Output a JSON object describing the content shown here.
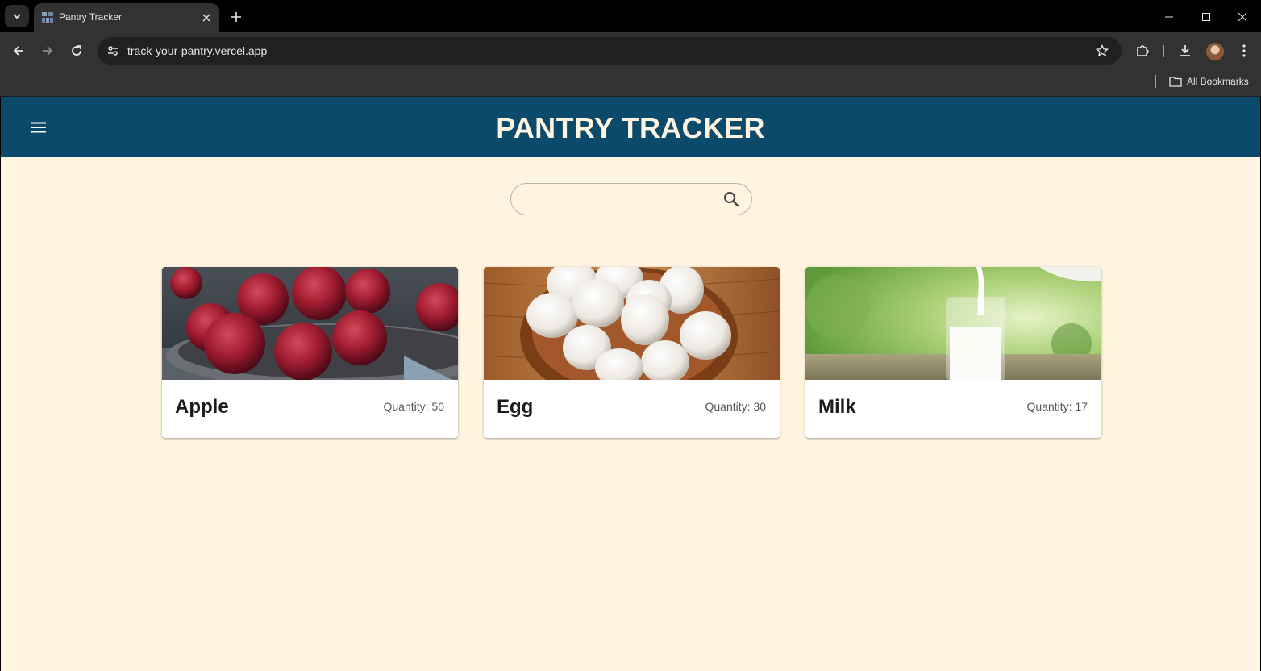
{
  "browser": {
    "tab_title": "Pantry Tracker",
    "url": "track-your-pantry.vercel.app",
    "bookmarks_label": "All Bookmarks"
  },
  "app": {
    "title": "PANTRY TRACKER",
    "search": {
      "value": "",
      "placeholder": ""
    }
  },
  "items": [
    {
      "name": "Apple",
      "quantity_label": "Quantity: 50",
      "quantity": 50,
      "image": "bowl of red apples"
    },
    {
      "name": "Egg",
      "quantity_label": "Quantity: 30",
      "quantity": 30,
      "image": "bowl of white eggs on wooden table"
    },
    {
      "name": "Milk",
      "quantity_label": "Quantity: 17",
      "quantity": 17,
      "image": "milk pouring into a glass"
    }
  ],
  "colors": {
    "header_bg": "#0c4a6b",
    "page_bg": "#fff4df",
    "title_text": "#fff4df"
  }
}
